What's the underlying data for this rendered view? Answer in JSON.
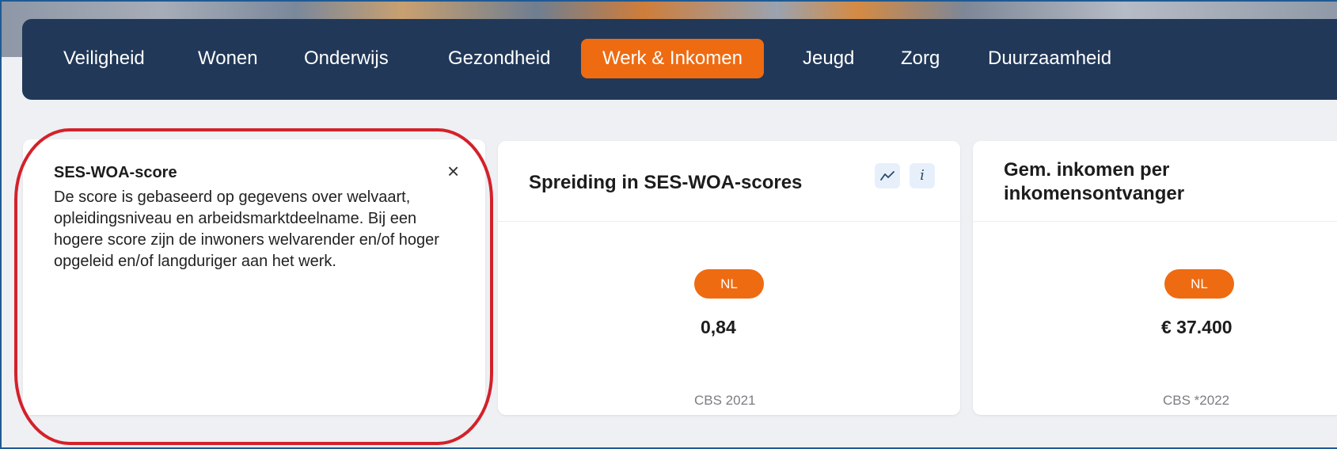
{
  "nav": {
    "items": [
      {
        "label": "Veiligheid"
      },
      {
        "label": "Wonen"
      },
      {
        "label": "Onderwijs"
      },
      {
        "label": "Gezondheid"
      },
      {
        "label": "Werk & Inkomen",
        "active": true
      },
      {
        "label": "Jeugd"
      },
      {
        "label": "Zorg"
      },
      {
        "label": "Duurzaamheid"
      }
    ]
  },
  "info_popup": {
    "title": "SES-WOA-score",
    "close_icon": "×",
    "body": "De score is gebaseerd op gegevens over welvaart, opleidingsniveau en arbeidsmarktdeelname. Bij een hogere score zijn de inwoners welvarender en/of hoger opgeleid en/of langduriger aan het werk."
  },
  "cards": [
    {
      "title": "Spreiding in SES-WOA-scores",
      "chart_icon": "trend-line",
      "info_icon": "i",
      "badge": "NL",
      "value": "0,84",
      "source": "CBS 2021"
    },
    {
      "title": "Gem. inkomen per inkomensontvanger",
      "badge": "NL",
      "value": "€ 37.400",
      "source": "CBS *2022"
    }
  ],
  "colors": {
    "nav_bg": "#213858",
    "accent": "#ee6b12",
    "highlight": "#d4212a",
    "page_bg": "#eef0f3"
  }
}
